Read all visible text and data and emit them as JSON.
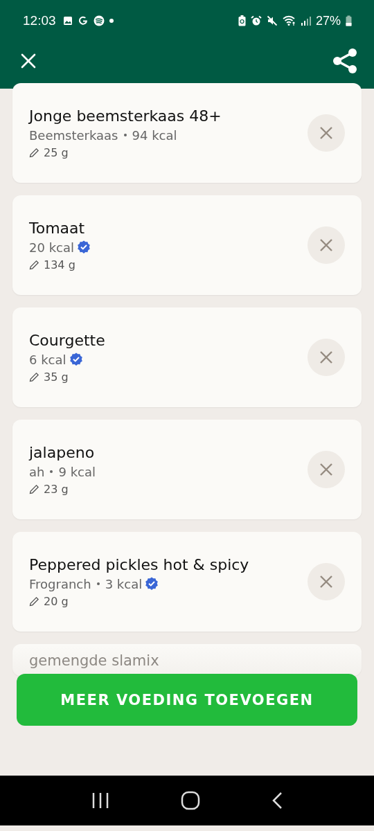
{
  "status_bar": {
    "time": "12:03",
    "battery": "27%"
  },
  "items": [
    {
      "name": "Jonge beemsterkaas 48+",
      "brand": "Beemsterkaas",
      "kcal": "94 kcal",
      "verified": false,
      "amount": "25 g"
    },
    {
      "name": "Tomaat",
      "kcal": "20 kcal",
      "verified": true,
      "amount": "134 g"
    },
    {
      "name": "Courgette",
      "kcal": "6 kcal",
      "verified": true,
      "amount": "35 g"
    },
    {
      "name": "jalapeno",
      "brand": "ah",
      "kcal": "9 kcal",
      "verified": false,
      "amount": "23 g"
    },
    {
      "name": "Peppered pickles hot & spicy",
      "brand": "Frogranch",
      "kcal": "3 kcal",
      "verified": true,
      "amount": "20 g"
    }
  ],
  "partial_item": {
    "name": "gemengde slamix"
  },
  "add_button": {
    "label": "MEER VOEDING TOEVOEGEN"
  }
}
